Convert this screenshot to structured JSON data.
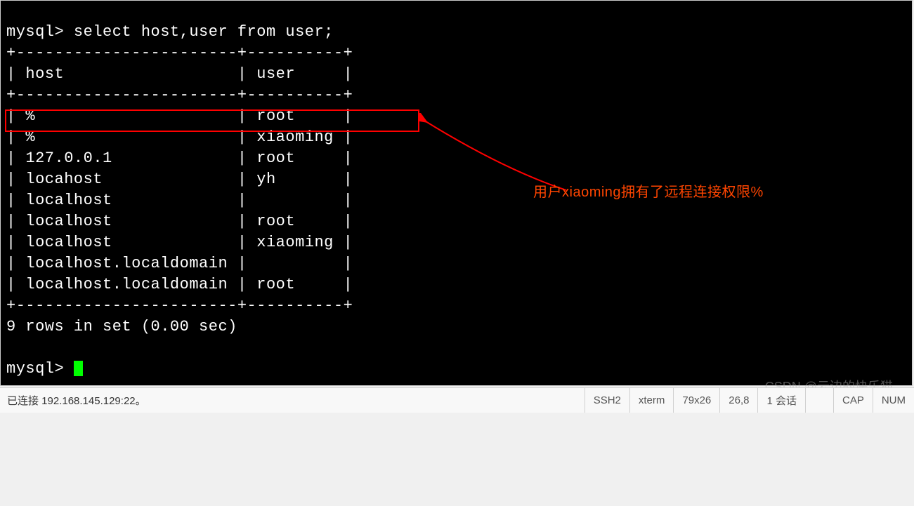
{
  "terminal": {
    "query_line": "mysql> select host,user from user;",
    "separator": "+-----------------------+----------+",
    "header": "| host                  | user     |",
    "rows": [
      "| %                     | root     |",
      "| %                     | xiaoming |",
      "| 127.0.0.1             | root     |",
      "| locahost              | yh       |",
      "| localhost             |          |",
      "| localhost             | root     |",
      "| localhost             | xiaoming |",
      "| localhost.localdomain |          |",
      "| localhost.localdomain | root     |"
    ],
    "summary": "9 rows in set (0.00 sec)",
    "prompt2": "mysql> "
  },
  "annotation": {
    "text": "用户xiaoming拥有了远程连接权限%"
  },
  "statusbar": {
    "connected": "已连接 192.168.145.129:22。",
    "protocol": "SSH2",
    "term": "xterm",
    "size": "79x26",
    "pos": "26,8",
    "sessions": "1 会话",
    "cap": "CAP",
    "num": "NUM"
  },
  "watermark": "CSDN @云边的快乐猫"
}
